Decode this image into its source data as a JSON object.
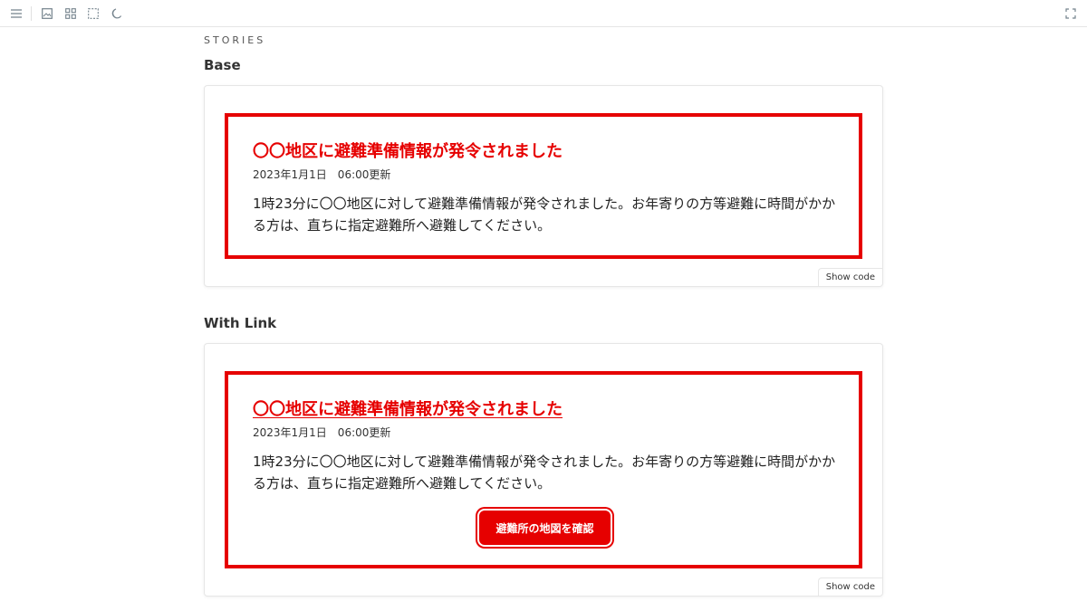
{
  "toolbar": {
    "icons": [
      "menu-icon",
      "image-icon",
      "grid-icon",
      "outline-icon",
      "moon-icon",
      "fullscreen-icon"
    ]
  },
  "stories_heading": "STORIES",
  "stories": [
    {
      "title": "Base",
      "alert": {
        "heading": "〇〇地区に避難準備情報が発令されました",
        "date": "2023年1月1日　06:00更新",
        "body": "1時23分に〇〇地区に対して避難準備情報が発令されました。お年寄りの方等避難に時間がかかる方は、直ちに指定避難所へ避難してください。"
      },
      "show_code_label": "Show code"
    },
    {
      "title": "With Link",
      "alert": {
        "heading": "〇〇地区に避難準備情報が発令されました",
        "date": "2023年1月1日　06:00更新",
        "body": "1時23分に〇〇地区に対して避難準備情報が発令されました。お年寄りの方等避難に時間がかかる方は、直ちに指定避難所へ避難してください。",
        "button_label": "避難所の地図を確認"
      },
      "show_code_label": "Show code"
    }
  ],
  "colors": {
    "alert_red": "#e60000",
    "border_gray": "#e6e6e6",
    "icon_gray": "#73828c"
  }
}
